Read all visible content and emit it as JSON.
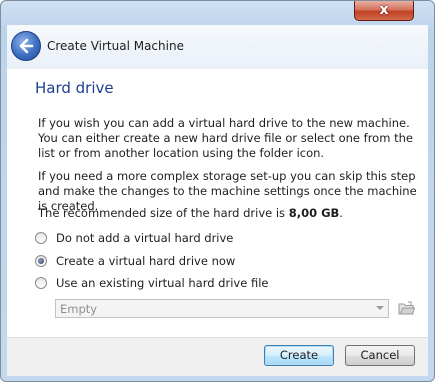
{
  "window": {
    "close_label": "x"
  },
  "header": {
    "title": "Create Virtual Machine"
  },
  "page": {
    "title": "Hard drive",
    "paragraph1": "If you wish you can add a virtual hard drive to the new machine. You can either create a new hard drive file or select one from the list or from another location using the folder icon.",
    "paragraph2": "If you need a more complex storage set-up you can skip this step and make the changes to the machine settings once the machine is created.",
    "recommended_prefix": "The recommended size of the hard drive is ",
    "recommended_size": "8,00 GB",
    "recommended_suffix": "."
  },
  "options": [
    {
      "label": "Do not add a virtual hard drive",
      "selected": false
    },
    {
      "label": "Create a virtual hard drive now",
      "selected": true
    },
    {
      "label": "Use an existing virtual hard drive file",
      "selected": false
    }
  ],
  "disk_select": {
    "value": "Empty",
    "enabled": false
  },
  "footer": {
    "create_label": "Create",
    "cancel_label": "Cancel"
  },
  "colors": {
    "accent": "#1c3f94",
    "titlebar": "#bcd3ec",
    "close": "#c24124"
  }
}
